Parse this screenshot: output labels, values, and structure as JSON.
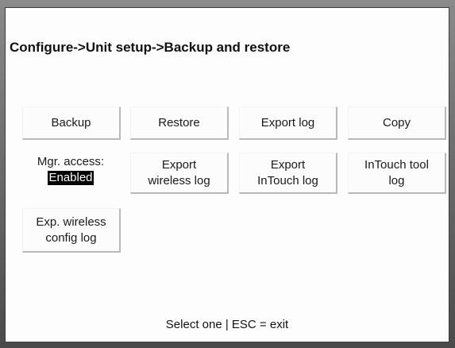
{
  "screen": {
    "breadcrumb": "Configure->Unit setup->Backup and restore",
    "footer": "Select one | ESC = exit"
  },
  "buttons": {
    "backup": "Backup",
    "restore": "Restore",
    "export_log": "Export log",
    "copy": "Copy",
    "export_wireless_log": [
      "Export",
      "wireless log"
    ],
    "export_intouch_log": [
      "Export",
      "InTouch log"
    ],
    "intouch_tool_log": [
      "InTouch tool",
      "log"
    ],
    "exp_wireless_config_log": [
      "Exp. wireless",
      "config log"
    ]
  },
  "mgr_access": {
    "label": "Mgr. access:",
    "value": "Enabled"
  }
}
